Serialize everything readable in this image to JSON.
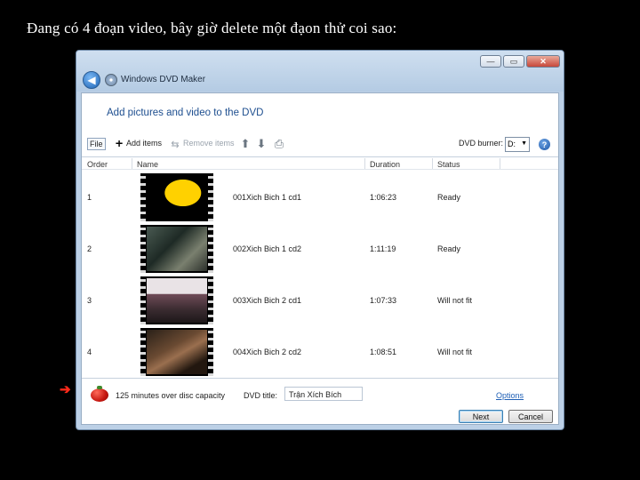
{
  "caption": "Đang có 4 đoạn video, bây giờ delete một đạon thử coi sao:",
  "window": {
    "app_title": "Windows DVD Maker",
    "controls": {
      "minimize": "—",
      "maximize": "▭",
      "close": "✕"
    }
  },
  "page": {
    "heading": "Add pictures and video to the DVD"
  },
  "toolbar": {
    "file": "File",
    "add_items": "Add items",
    "remove_items": "Remove items",
    "dvd_burner_label": "DVD burner:",
    "dvd_burner_value": "D:",
    "help": "?"
  },
  "table": {
    "columns": [
      "Order",
      "Name",
      "Duration",
      "Status"
    ],
    "rows": [
      {
        "order": "1",
        "name": "001Xich Bich 1 cd1",
        "duration": "1:06:23",
        "status": "Ready"
      },
      {
        "order": "2",
        "name": "002Xich Bich 1 cd2",
        "duration": "1:11:19",
        "status": "Ready"
      },
      {
        "order": "3",
        "name": "003Xich Bich 2 cd1",
        "duration": "1:07:33",
        "status": "Will not fit"
      },
      {
        "order": "4",
        "name": "004Xich Bich 2 cd2",
        "duration": "1:08:51",
        "status": "Will not fit"
      }
    ]
  },
  "footer": {
    "capacity_text": "125 minutes over disc capacity",
    "dvd_title_label": "DVD title:",
    "dvd_title_value": "Trận Xích Bích",
    "options_link": "Options",
    "next_button": "Next",
    "cancel_button": "Cancel"
  },
  "annotation": {
    "arrow": "➔"
  }
}
